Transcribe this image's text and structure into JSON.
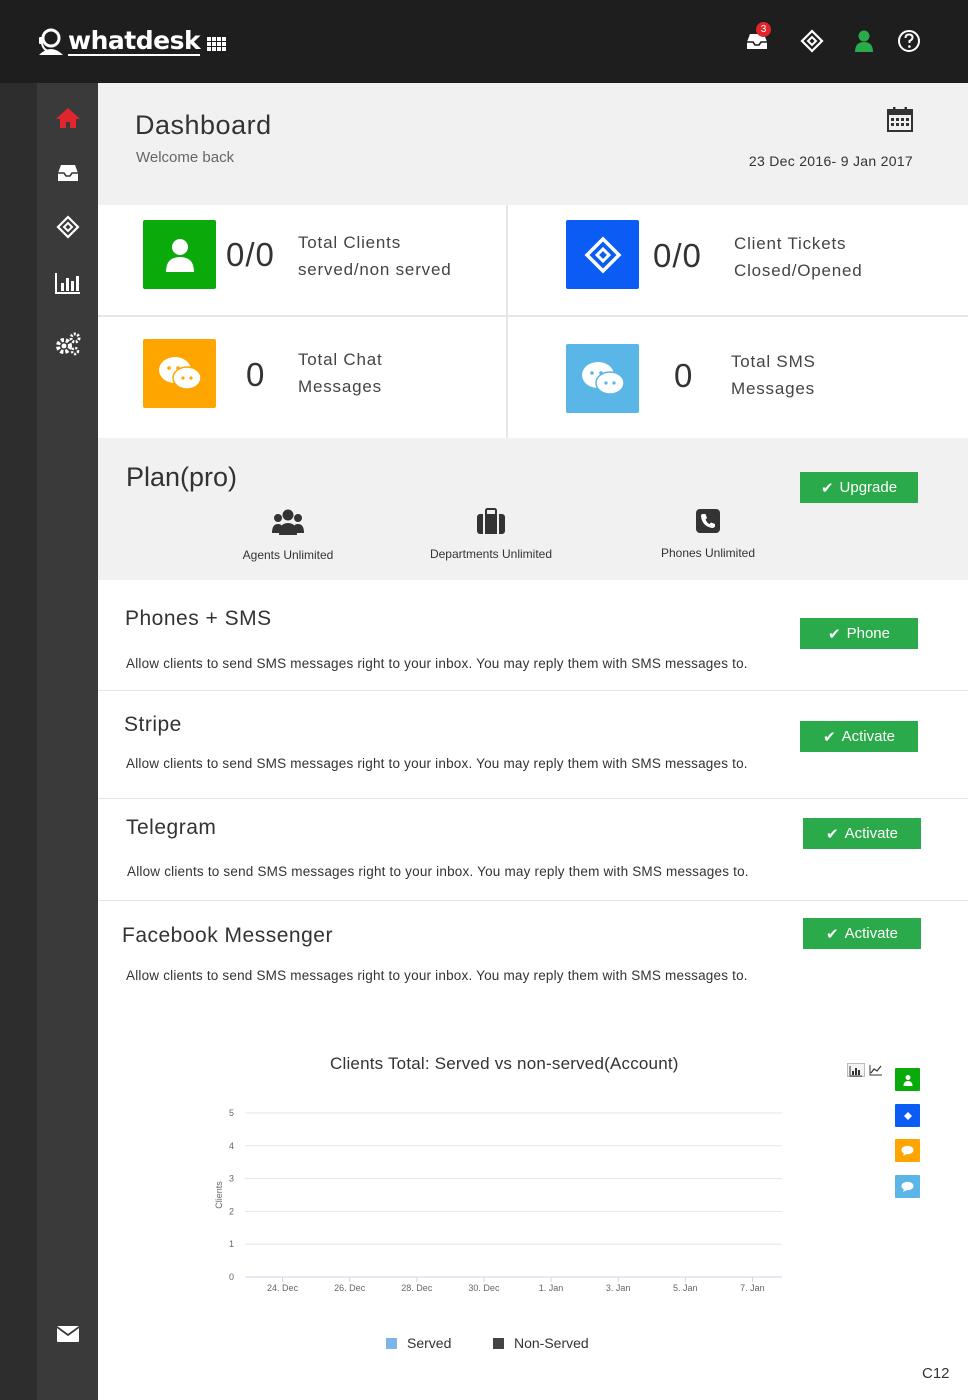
{
  "app": {
    "logo_text": "whatdesk"
  },
  "topbar": {
    "inbox_badge": "3"
  },
  "colors": {
    "green": "#0aaa0a",
    "blue": "#0a5cf4",
    "orange": "#ffa500",
    "light_blue": "#59b6e6",
    "button_green": "#2aaa4a",
    "home_red": "#e0262c"
  },
  "header": {
    "title": "Dashboard",
    "subtitle": "Welcome back",
    "date_range": "23 Dec 2016- 9 Jan 2017"
  },
  "stats": [
    {
      "value": "0/0",
      "label_line1": "Total Clients",
      "label_line2": "served/non served"
    },
    {
      "value": "0/0",
      "label_line1": "Client Tickets",
      "label_line2": "Closed/Opened"
    },
    {
      "value": "0",
      "label_line1": "Total Chat",
      "label_line2": "Messages"
    },
    {
      "value": "0",
      "label_line1": "Total SMS",
      "label_line2": "Messages"
    }
  ],
  "plan": {
    "title": "Plan(pro)",
    "upgrade_label": "Upgrade",
    "features": [
      "Agents Unlimited",
      "Departments Unlimited",
      "Phones Unlimited"
    ]
  },
  "integrations": [
    {
      "title": "Phones + SMS",
      "description": "Allow clients to send SMS messages right to your inbox. You may reply them with SMS messages to.",
      "button": "Phone"
    },
    {
      "title": "Stripe",
      "description": "Allow clients to send SMS messages right to your inbox. You may reply them with SMS messages to.",
      "button": "Activate"
    },
    {
      "title": "Telegram",
      "description": "Allow clients to send SMS messages right to your inbox. You may reply them with SMS messages to.",
      "button": "Activate"
    },
    {
      "title": "Facebook Messenger",
      "description": "Allow clients to send SMS messages right to your inbox. You may reply them with SMS messages to.",
      "button": "Activate"
    }
  ],
  "chart_data": {
    "type": "line",
    "title": "Clients Total: Served vs non-served(Account)",
    "xlabel": "",
    "ylabel": "Clients",
    "ylim": [
      0,
      5
    ],
    "y_ticks": [
      "0",
      "1",
      "2",
      "3",
      "4",
      "5"
    ],
    "categories": [
      "24. Dec",
      "26. Dec",
      "28. Dec",
      "30. Dec",
      "1. Jan",
      "3. Jan",
      "5. Jan",
      "7. Jan"
    ],
    "series": [
      {
        "name": "Served",
        "color": "#7cb5ec",
        "values": [
          0,
          0,
          0,
          0,
          0,
          0,
          0,
          0
        ]
      },
      {
        "name": "Non-Served",
        "color": "#434348",
        "values": [
          0,
          0,
          0,
          0,
          0,
          0,
          0,
          0
        ]
      }
    ],
    "legend": "bottom-center",
    "grid": true
  },
  "footer": {
    "tag": "C12"
  }
}
